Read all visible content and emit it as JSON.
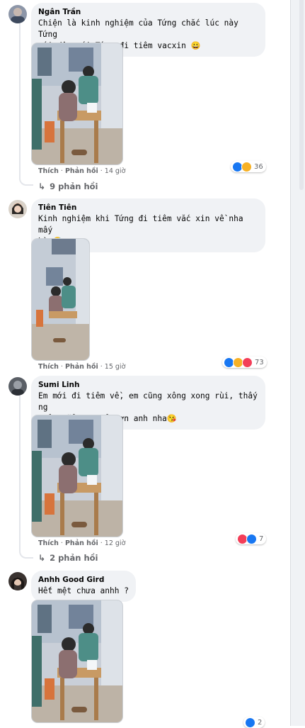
{
  "comments": [
    {
      "author": "Ngân Trần",
      "text_line1": "Chiện là kinh nghiệm của Tứng chắc lúc này Tứng",
      "text_line2": "mới dậy cái Tứng đi tiêm vacxin 😀",
      "like": "Thích",
      "reply": "Phản hồi",
      "time": "14 giờ",
      "reaction_count": "36",
      "reaction_icons": [
        "like-icon",
        "haha-icon"
      ],
      "replies_label": "9 phản hồi"
    },
    {
      "author": "Tiên Tiên",
      "text_line1": "Kinh nghiệm khi Tứng đi tiêm vắc xin về nha mấy",
      "text_line2": "bà 🤣",
      "like": "Thích",
      "reply": "Phản hồi",
      "time": "15 giờ",
      "reaction_count": "73",
      "reaction_icons": [
        "like-icon",
        "haha-icon",
        "love-icon"
      ]
    },
    {
      "author": "Sumi Linh",
      "text_line1": "Em mới đi tiêm về, em cũng xông xong rùi, thấy ng",
      "text_line2": "khỏe hẳn ra. Cảm ơn anh nha😘",
      "like": "Thích",
      "reply": "Phản hồi",
      "time": "12 giờ",
      "reaction_count": "7",
      "reaction_icons": [
        "love-icon",
        "like-icon"
      ],
      "replies_label": "2 phản hồi"
    },
    {
      "author": "Anhh Good Gird",
      "text_line1": "Hết mệt chưa anhh ?",
      "reaction_count": "2",
      "reaction_icons": [
        "like-icon"
      ]
    }
  ],
  "colors": {
    "bubble": "#f0f2f5",
    "like": "#1877f2",
    "love": "#f33e58",
    "haha": "#f7b125",
    "meta": "#65676b"
  }
}
